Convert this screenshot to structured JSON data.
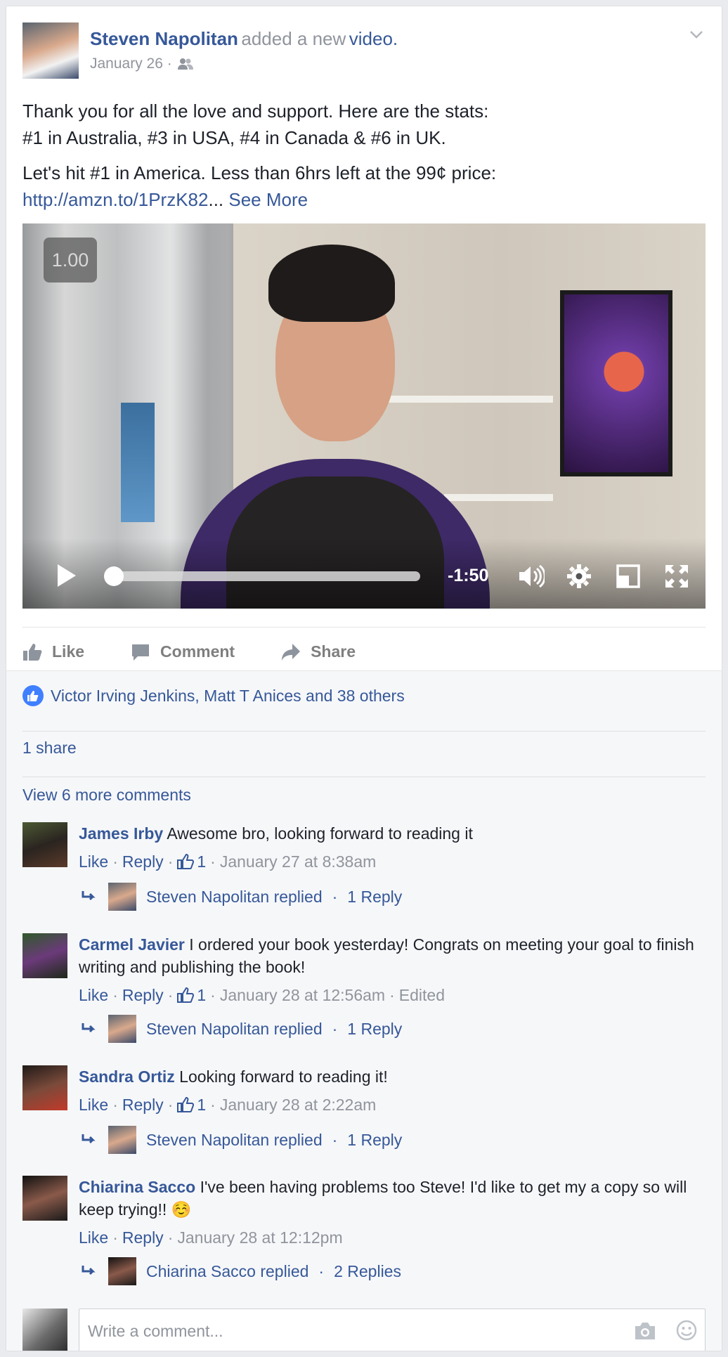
{
  "post": {
    "author": "Steven Napolitan",
    "action_text": "added a new",
    "action_link": "video.",
    "date": "January 26 ·",
    "text_line1": "Thank you for all the love and support. Here are the stats:",
    "text_line2": "#1 in Australia, #3 in USA, #4 in Canada & #6 in UK.",
    "text_line3": "Let's hit #1 in America. Less than 6hrs left at the 99¢ price:",
    "link": "http://amzn.to/1PrzK82",
    "ellipsis": "...",
    "see_more": "See More"
  },
  "video": {
    "speed": "1.00",
    "time_remaining": "-1:50",
    "progress": 0.0
  },
  "actions": {
    "like": "Like",
    "comment": "Comment",
    "share": "Share"
  },
  "social": {
    "likes_text": "Victor Irving Jenkins, Matt T Anices and 38 others",
    "shares_text": "1 share",
    "view_more": "View 6 more comments"
  },
  "comments": [
    {
      "name": "James Irby",
      "text": "Awesome bro, looking forward to reading it",
      "like": "Like",
      "reply": "Reply",
      "likes": "1",
      "time": "January 27 at 8:38am",
      "edited": "",
      "reply_by": "Steven Napolitan replied",
      "reply_count": "1 Reply"
    },
    {
      "name": "Carmel Javier",
      "text": "I ordered your book yesterday! Congrats on meeting your goal to finish writing and publishing the book!",
      "like": "Like",
      "reply": "Reply",
      "likes": "1",
      "time": "January 28 at 12:56am",
      "edited": "Edited",
      "reply_by": "Steven Napolitan replied",
      "reply_count": "1 Reply"
    },
    {
      "name": "Sandra Ortiz",
      "text": "Looking forward to reading it!",
      "like": "Like",
      "reply": "Reply",
      "likes": "1",
      "time": "January 28 at 2:22am",
      "edited": "",
      "reply_by": "Steven Napolitan replied",
      "reply_count": "1 Reply"
    },
    {
      "name": "Chiarina Sacco",
      "text": "I've been having problems too Steve! I'd like to get my a copy so will keep trying!! ☺️",
      "like": "Like",
      "reply": "Reply",
      "likes": "",
      "time": "January 28 at 12:12pm",
      "edited": "",
      "reply_by": "Chiarina Sacco replied",
      "reply_count": "2 Replies"
    }
  ],
  "composer": {
    "placeholder": "Write a comment..."
  },
  "colors": {
    "link": "#365899",
    "meta": "#90949c",
    "like_badge": "#4080ff"
  }
}
